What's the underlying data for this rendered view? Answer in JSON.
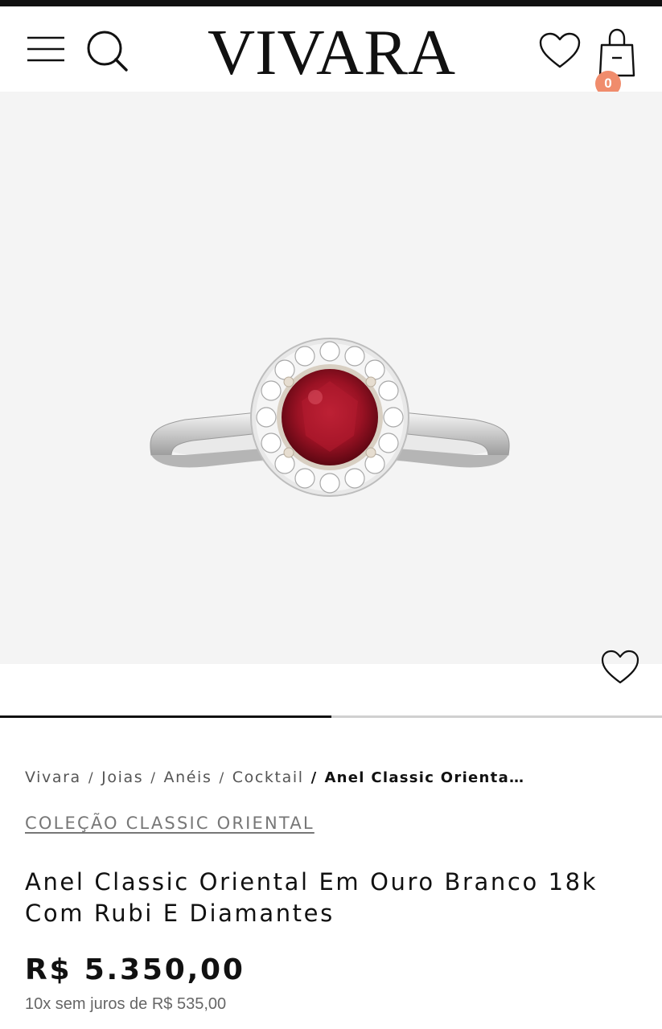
{
  "header": {
    "logo_text": "VIVARA",
    "cart_count": "0",
    "icons": [
      "menu-icon",
      "search-icon",
      "heart-icon",
      "bag-icon"
    ]
  },
  "gallery": {
    "image_description_icon": "ring-image",
    "progress_fraction": 0.5,
    "favorite_icon": "heart-outline-icon"
  },
  "breadcrumb": {
    "items": [
      "Vivara",
      "Joias",
      "Anéis",
      "Cocktail"
    ],
    "separator": "/",
    "current": "Anel Classic Orienta…"
  },
  "product": {
    "collection": "COLEÇÃO CLASSIC ORIENTAL",
    "title": "Anel Classic Oriental Em Ouro Branco 18k Com Rubi E Diamantes",
    "price": "R$ 5.350,00",
    "installments": "10x sem juros de R$ 535,00"
  },
  "colors": {
    "accent_badge": "#f08c6c",
    "ruby": "#9b1224",
    "text": "#111111"
  }
}
